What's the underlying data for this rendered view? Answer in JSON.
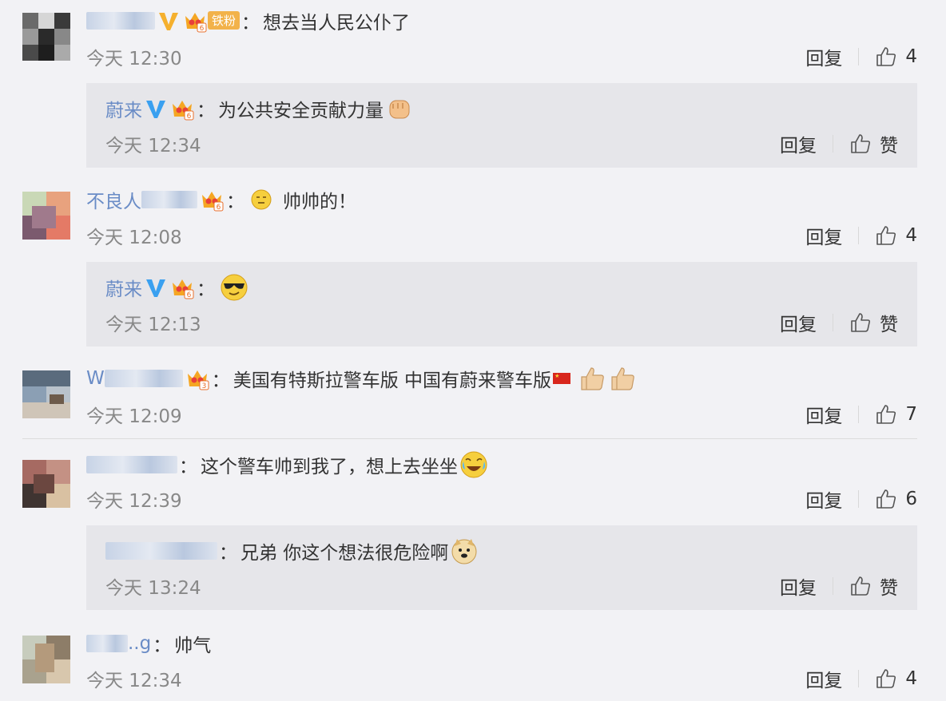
{
  "labels": {
    "reply": "回复",
    "like": "赞"
  },
  "comments": [
    {
      "name_suffix": "",
      "fan_tag": "铁粉",
      "text": "想去当人民公仆了",
      "time": "今天 12:30",
      "likes": "4",
      "reply": {
        "name": "蔚来",
        "text": "为公共安全贡献力量",
        "time": "今天 12:34"
      }
    },
    {
      "name_prefix": "不良人",
      "text": "帅帅的！",
      "time": "今天 12:08",
      "likes": "4",
      "reply": {
        "name": "蔚来",
        "text": "",
        "time": "今天 12:13"
      }
    },
    {
      "name_prefix": "W",
      "text": "美国有特斯拉警车版 中国有蔚来警车版",
      "time": "今天 12:09",
      "likes": "7"
    },
    {
      "text": "这个警车帅到我了，想上去坐坐",
      "time": "今天 12:39",
      "likes": "6",
      "reply": {
        "text": "兄弟 你这个想法很危险啊",
        "time": "今天 13:24"
      }
    },
    {
      "name_suffix": "..g",
      "text": "帅气",
      "time": "今天 12:34",
      "likes": "4"
    }
  ],
  "colors": {
    "username": "#6a8cc6",
    "vbadge_gold": "#f5b02e",
    "vbadge_blue": "#3aa0f0",
    "background": "#f2f2f5",
    "reply_background": "#e6e6ea"
  }
}
